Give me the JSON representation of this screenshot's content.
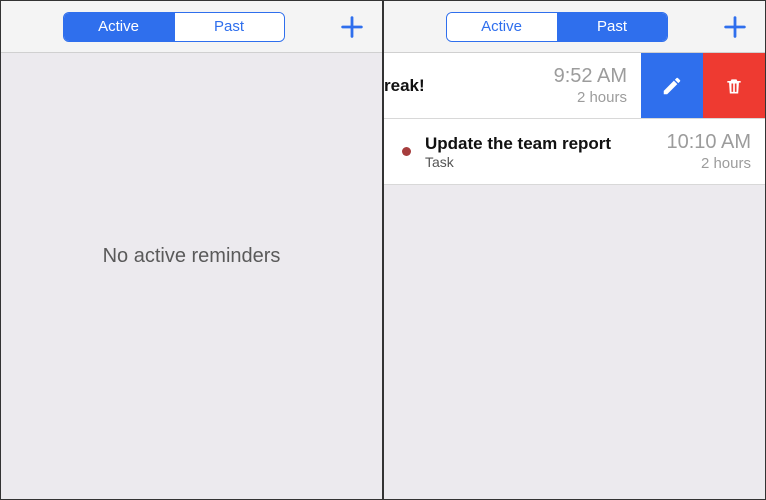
{
  "left": {
    "tabs": {
      "active": "Active",
      "past": "Past",
      "selected": "active"
    },
    "empty_message": "No active reminders"
  },
  "right": {
    "tabs": {
      "active": "Active",
      "past": "Past",
      "selected": "past"
    },
    "items": [
      {
        "title_fragment": "reak!",
        "time": "9:52 AM",
        "duration": "2 hours",
        "swiped": true
      },
      {
        "title": "Update the team report",
        "subtitle": "Task",
        "time": "10:10 AM",
        "duration": "2 hours",
        "status_dot": true
      }
    ]
  },
  "icons": {
    "add": "plus-icon",
    "edit": "pencil-icon",
    "delete": "trash-icon"
  },
  "colors": {
    "accent": "#2f6fed",
    "danger": "#ee3a31",
    "status_dot": "#a63d3d"
  }
}
